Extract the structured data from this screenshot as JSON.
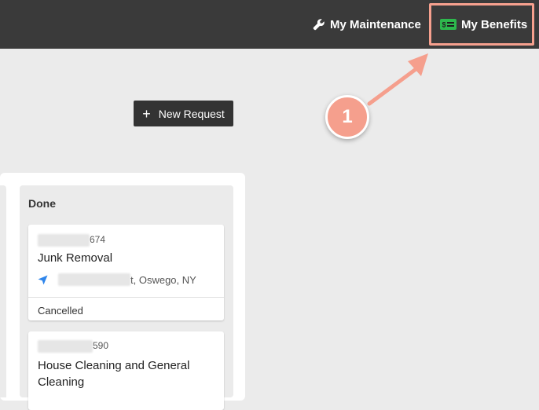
{
  "header": {
    "nav": [
      {
        "label": "My Maintenance",
        "icon": "wrench-icon"
      },
      {
        "label": "My Benefits",
        "icon": "money-bill-icon"
      }
    ],
    "benefits_icon_color": "#2db84d",
    "highlight_color": "#f6a08e"
  },
  "toolbar": {
    "new_request_label": "New Request"
  },
  "annotation": {
    "step_number": "1"
  },
  "board": {
    "column": {
      "title": "Done",
      "cards": [
        {
          "id_suffix": "674",
          "title": "Junk Removal",
          "location_suffix": "t, Oswego, NY",
          "status": "Cancelled"
        },
        {
          "id_suffix": "590",
          "title": "House Cleaning and General Cleaning"
        }
      ]
    }
  }
}
